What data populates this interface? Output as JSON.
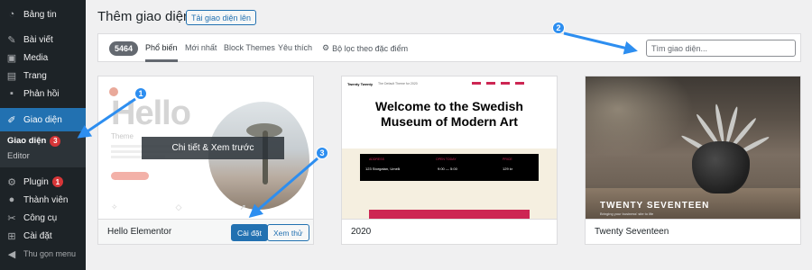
{
  "sidebar": {
    "items": [
      {
        "label": "Bảng tin",
        "icon": "dashboard-icon"
      },
      {
        "label": "Bài viết",
        "icon": "pin-icon"
      },
      {
        "label": "Media",
        "icon": "media-icon"
      },
      {
        "label": "Trang",
        "icon": "page-icon"
      },
      {
        "label": "Phản hồi",
        "icon": "comment-icon"
      },
      {
        "label": "Giao diện",
        "icon": "brush-icon"
      }
    ],
    "submenu": [
      {
        "label": "Giao diện",
        "badge": "3"
      },
      {
        "label": "Editor"
      }
    ],
    "items_after": [
      {
        "label": "Plugin",
        "icon": "plugin-icon",
        "badge": "1"
      },
      {
        "label": "Thành viên",
        "icon": "user-icon"
      },
      {
        "label": "Công cụ",
        "icon": "tool-icon"
      },
      {
        "label": "Cài đặt",
        "icon": "settings-icon"
      }
    ],
    "collapse_label": "Thu gọn menu"
  },
  "header": {
    "title": "Thêm giao diện",
    "upload_label": "Tải giao diện lên"
  },
  "filter": {
    "count": "5464",
    "tabs": [
      "Phổ biến",
      "Mới nhất",
      "Block Themes",
      "Yêu thích"
    ],
    "feature_filter": "Bộ lọc theo đặc điểm",
    "search_placeholder": "Tìm giao diện..."
  },
  "themes": [
    {
      "name": "Hello Elementor",
      "overlay": "Chi tiết & Xem trước",
      "install_label": "Cài đặt",
      "preview_label": "Xem thử",
      "preview_text": {
        "big": "Hello",
        "small": "Theme"
      }
    },
    {
      "name": "2020",
      "preview_text": {
        "brand": "Twenty Twenty",
        "tagline": "The Default Theme for 2020",
        "headline": "Welcome to the Swedish Museum of Modern Art",
        "address_label": "ADDRESS",
        "address": "123 Storgatan, Umeå",
        "hours_label": "OPEN TODAY",
        "hours": "9:00 — 5:00",
        "price_label": "PRICE",
        "price": "129 kr"
      }
    },
    {
      "name": "Twenty Seventeen",
      "preview_text": {
        "title": "TWENTY SEVENTEEN",
        "subtitle": "Bringing your business' site to life"
      }
    }
  ],
  "annotations": [
    "1",
    "2",
    "3"
  ],
  "colors": {
    "accent": "#2271b1",
    "sidebar": "#1d2327",
    "badge": "#d63638",
    "annotation": "#2d8ef0"
  }
}
